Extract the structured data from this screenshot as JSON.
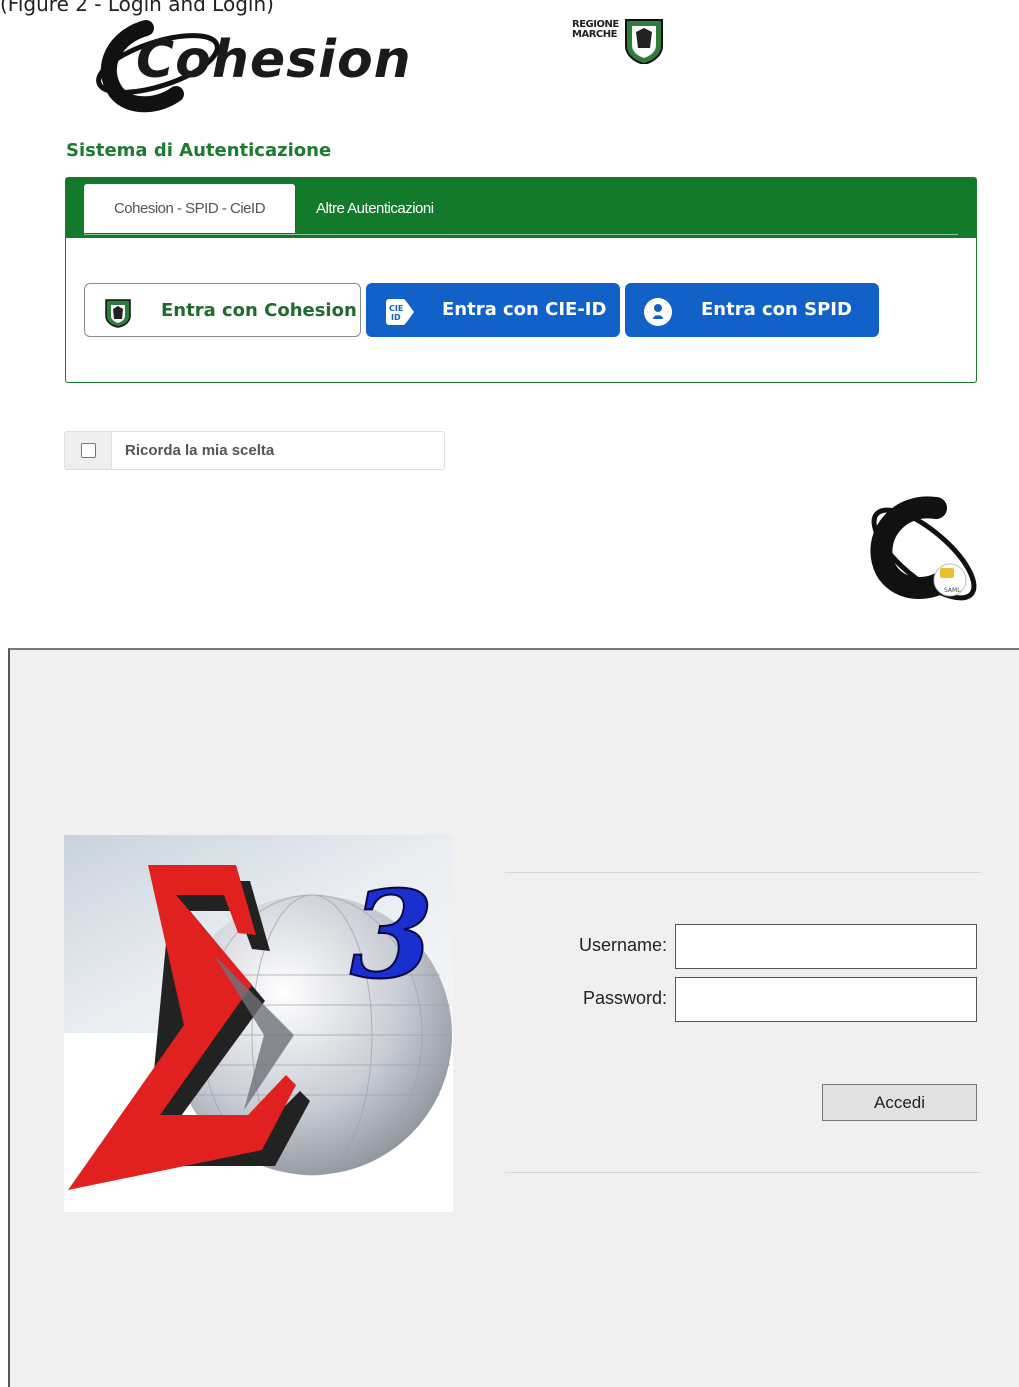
{
  "page_caption": "(Figure 2 - Login and Login)",
  "header": {
    "brand": "Cohesion",
    "partner_logo_text": [
      "REGIONE",
      "MARCHE"
    ]
  },
  "auth": {
    "title": "Sistema di Autenticazione",
    "tabs": [
      {
        "label": "Cohesion - SPID - CieID",
        "active": true
      },
      {
        "label": "Altre Autenticazioni",
        "active": false
      }
    ],
    "buttons": {
      "cohesion": "Entra con Cohesion",
      "cie": "Entra con CIE-ID",
      "spid": "Entra con SPID"
    },
    "remember_label": "Ricorda la mia scelta",
    "remember_checked": false
  },
  "login_form": {
    "username_label": "Username:",
    "password_label": "Password:",
    "username_value": "",
    "password_value": "",
    "submit_label": "Accedi"
  },
  "colors": {
    "green": "#137a2b",
    "blue": "#1261c9",
    "sigma_red": "#e0211f",
    "sigma_blue": "#1a2fd0"
  },
  "icons": [
    "cohesion-logo-icon",
    "regione-marche-logo-icon",
    "shield-icon",
    "cie-id-icon",
    "spid-user-icon",
    "checkbox-icon",
    "cohesion-saml-icon",
    "sigma3-logo-icon"
  ]
}
